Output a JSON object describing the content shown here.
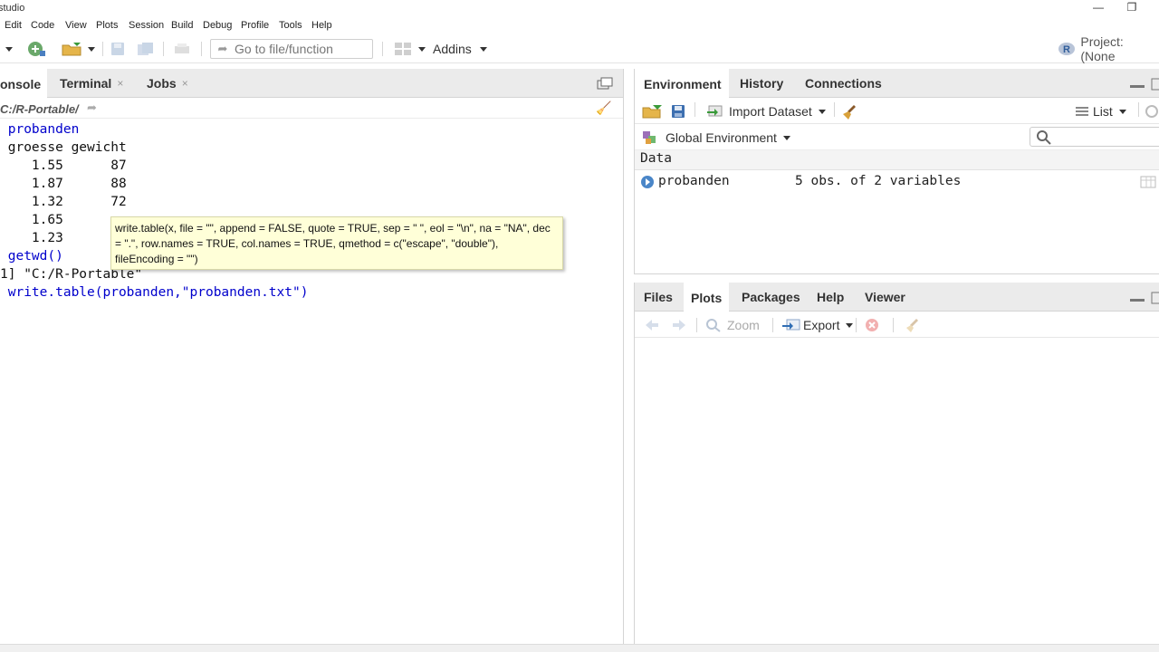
{
  "window": {
    "title": "studio",
    "minimize": "—",
    "restore": "❐"
  },
  "menu": [
    "Edit",
    "Code",
    "View",
    "Plots",
    "Session",
    "Build",
    "Debug",
    "Profile",
    "Tools",
    "Help"
  ],
  "toolbar": {
    "goto_placeholder": "Go to file/function",
    "addins": "Addins",
    "project": "Project: (None"
  },
  "console_pane": {
    "tabs": [
      {
        "label": "onsole"
      },
      {
        "label": "Terminal",
        "close": "×"
      },
      {
        "label": "Jobs",
        "close": "×"
      }
    ],
    "path": "C:/R-Portable/",
    "lines": [
      {
        "text": " probanden",
        "kind": "cmd"
      },
      {
        "text": " groesse gewicht",
        "kind": "out"
      },
      {
        "text": "    1.55      87",
        "kind": "out"
      },
      {
        "text": "    1.87      88",
        "kind": "out"
      },
      {
        "text": "    1.32      72",
        "kind": "out"
      },
      {
        "text": "    1.65",
        "kind": "out"
      },
      {
        "text": "    1.23",
        "kind": "out"
      },
      {
        "text": " getwd()",
        "kind": "cmd"
      },
      {
        "text": "1] \"C:/R-Portable\"",
        "kind": "out"
      },
      {
        "text": " write.table(probanden,\"probanden.txt\")",
        "kind": "cmd"
      }
    ],
    "tooltip": "write.table(x, file = \"\", append = FALSE, quote = TRUE, sep = \" \", eol = \"\\n\", na = \"NA\", dec = \".\", row.names = TRUE, col.names = TRUE, qmethod = c(\"escape\", \"double\"), fileEncoding = \"\")"
  },
  "env_pane": {
    "tabs": [
      "Environment",
      "History",
      "Connections"
    ],
    "import_label": "Import Dataset",
    "list_label": "List",
    "scope": "Global Environment",
    "section": "Data",
    "rows": [
      {
        "name": "probanden",
        "value": "5 obs. of 2 variables"
      }
    ]
  },
  "files_pane": {
    "tabs": [
      "Files",
      "Plots",
      "Packages",
      "Help",
      "Viewer"
    ],
    "zoom": "Zoom",
    "export": "Export"
  },
  "colors": {
    "accent": "#2e6db4",
    "command": "#0000cc",
    "tooltip_bg": "#ffffd8"
  }
}
